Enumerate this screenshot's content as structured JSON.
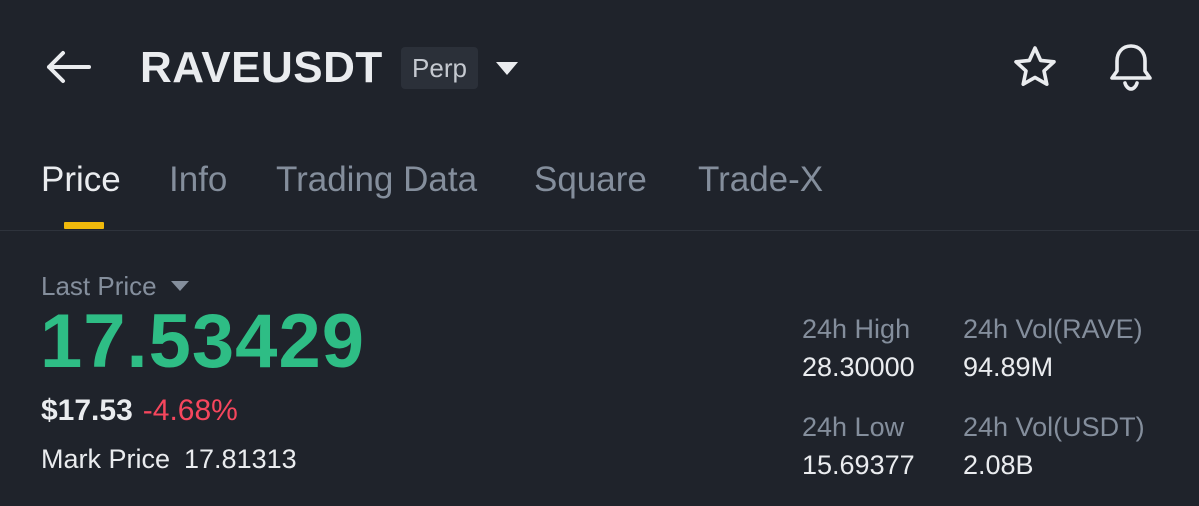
{
  "header": {
    "symbol": "RAVEUSDT",
    "contract_type": "Perp",
    "icons": {
      "back": "arrow-left-icon",
      "dropdown": "caret-down-icon",
      "favorite": "star-icon",
      "alerts": "bell-icon"
    }
  },
  "tabs": [
    {
      "label": "Price",
      "active": true
    },
    {
      "label": "Info",
      "active": false
    },
    {
      "label": "Trading Data",
      "active": false
    },
    {
      "label": "Square",
      "active": false
    },
    {
      "label": "Trade-X",
      "active": false
    }
  ],
  "price": {
    "label": "Last Price",
    "last": "17.53429",
    "usd": "$17.53",
    "change_pct": "-4.68%",
    "mark_label": "Mark Price",
    "mark_value": "17.81313"
  },
  "stats": {
    "high": {
      "label": "24h High",
      "value": "28.30000"
    },
    "vol_base": {
      "label": "24h Vol(RAVE)",
      "value": "94.89M"
    },
    "low": {
      "label": "24h Low",
      "value": "15.69377"
    },
    "vol_quote": {
      "label": "24h Vol(USDT)",
      "value": "2.08B"
    }
  },
  "colors": {
    "background": "#1f232b",
    "up": "#2ebd85",
    "down": "#f6465d",
    "accent": "#f0b90b",
    "muted": "#848e9c"
  }
}
